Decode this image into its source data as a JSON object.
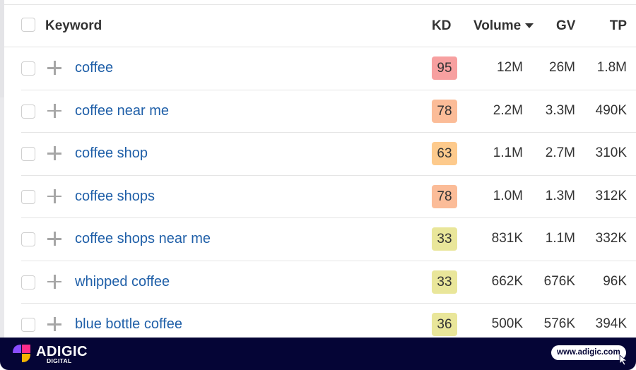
{
  "table": {
    "headers": {
      "keyword": "Keyword",
      "kd": "KD",
      "volume": "Volume",
      "gv": "GV",
      "tp": "TP"
    },
    "sort": {
      "column": "volume",
      "direction": "descending"
    },
    "kd_colors": {
      "very_hard": "#f5a3a3",
      "hard": "#fbbb96",
      "medium": "#fdcb8e",
      "easy": "#e8e69a"
    },
    "rows": [
      {
        "keyword": "coffee",
        "kd": "95",
        "kd_color": "#f7a0a0",
        "volume": "12M",
        "gv": "26M",
        "tp": "1.8M"
      },
      {
        "keyword": "coffee near me",
        "kd": "78",
        "kd_color": "#fbbc98",
        "volume": "2.2M",
        "gv": "3.3M",
        "tp": "490K"
      },
      {
        "keyword": "coffee shop",
        "kd": "63",
        "kd_color": "#fdca8c",
        "volume": "1.1M",
        "gv": "2.7M",
        "tp": "310K"
      },
      {
        "keyword": "coffee shops",
        "kd": "78",
        "kd_color": "#fbbc98",
        "volume": "1.0M",
        "gv": "1.3M",
        "tp": "312K"
      },
      {
        "keyword": "coffee shops near me",
        "kd": "33",
        "kd_color": "#e9e69a",
        "volume": "831K",
        "gv": "1.1M",
        "tp": "332K"
      },
      {
        "keyword": "whipped coffee",
        "kd": "33",
        "kd_color": "#e9e69a",
        "volume": "662K",
        "gv": "676K",
        "tp": "96K"
      },
      {
        "keyword": "blue bottle coffee",
        "kd": "36",
        "kd_color": "#e9e69a",
        "volume": "500K",
        "gv": "576K",
        "tp": "394K"
      }
    ]
  },
  "footer": {
    "brand": "ADIGIC",
    "brand_sub": "DIGITAL",
    "url": "www.adigic.com",
    "background": "#050536"
  }
}
